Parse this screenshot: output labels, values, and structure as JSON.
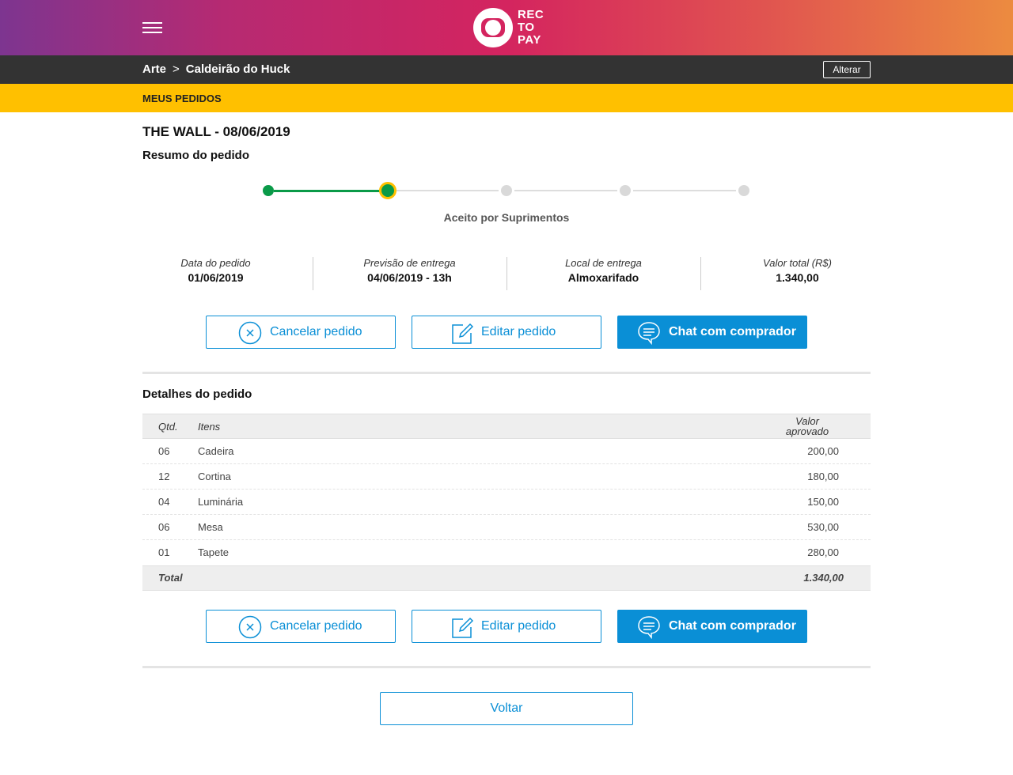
{
  "header": {
    "menu_icon": "hamburger-menu-icon",
    "logo_text": [
      "REC",
      "TO",
      "PAY"
    ]
  },
  "breadcrumb": {
    "items": [
      "Arte",
      "Caldeirão do Huck"
    ],
    "separator": ">",
    "change_label": "Alterar"
  },
  "section": {
    "title": "MEUS PEDIDOS"
  },
  "order": {
    "title": "THE WALL - 08/06/2019",
    "summary_label": "Resumo do pedido",
    "progress": {
      "total_steps": 5,
      "current_step": 2,
      "current_label": "Aceito por Suprimentos"
    },
    "info": [
      {
        "label": "Data do pedido",
        "value": "01/06/2019"
      },
      {
        "label": "Previsão de entrega",
        "value": "04/06/2019 - 13h"
      },
      {
        "label": "Local de entrega",
        "value": "Almoxarifado"
      },
      {
        "label": "Valor total (R$)",
        "value": "1.340,00"
      }
    ]
  },
  "actions": {
    "cancel": {
      "label": "Cancelar pedido",
      "icon": "circle-x-icon"
    },
    "edit": {
      "label": "Editar pedido",
      "icon": "edit-pencil-icon"
    },
    "chat": {
      "label": "Chat com comprador",
      "icon": "chat-bubble-icon"
    }
  },
  "details": {
    "label": "Detalhes do pedido",
    "columns": {
      "qty": "Qtd.",
      "items": "Itens",
      "value_line1": "Valor",
      "value_line2": "aprovado"
    },
    "rows": [
      {
        "qty": "06",
        "item": "Cadeira",
        "value": "200,00"
      },
      {
        "qty": "12",
        "item": "Cortina",
        "value": "180,00"
      },
      {
        "qty": "04",
        "item": "Luminária",
        "value": "150,00"
      },
      {
        "qty": "06",
        "item": "Mesa",
        "value": "530,00"
      },
      {
        "qty": "01",
        "item": "Tapete",
        "value": "280,00"
      }
    ],
    "total_label": "Total",
    "total_value": "1.340,00"
  },
  "back_label": "Voltar",
  "colors": {
    "accent_blue": "#0a8fd6",
    "section_yellow": "#ffc000",
    "progress_green": "#0a9a48",
    "crumb_bar": "#333333"
  }
}
